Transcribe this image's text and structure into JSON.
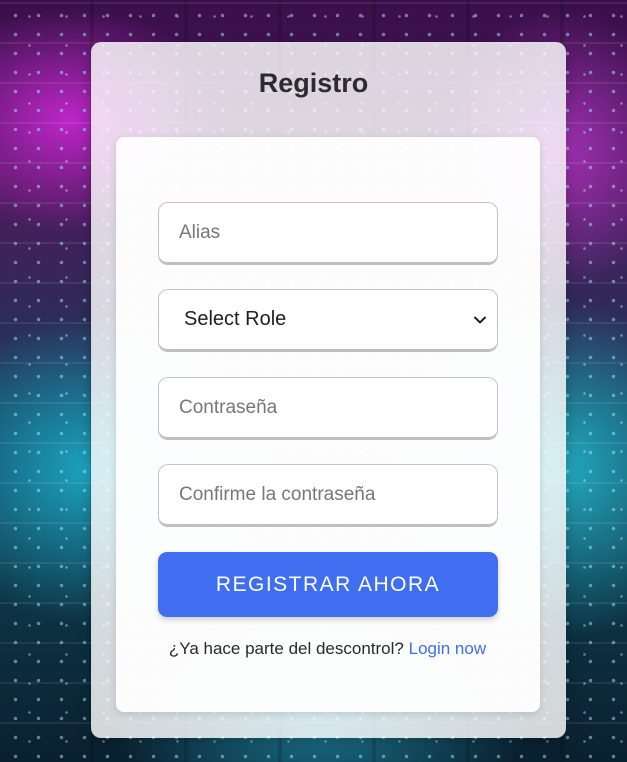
{
  "form": {
    "title": "Registro",
    "alias_placeholder": "Alias",
    "role_select": {
      "selected": "Select Role"
    },
    "password_placeholder": "Contraseña",
    "confirm_password_placeholder": "Confirme la contraseña",
    "submit_label": "REGISTRAR AHORA",
    "footer_text": "¿Ya hace parte del descontrol?",
    "login_link": "Login now"
  },
  "colors": {
    "accent": "#3f6ff0",
    "title_text": "#2c2c2c"
  }
}
